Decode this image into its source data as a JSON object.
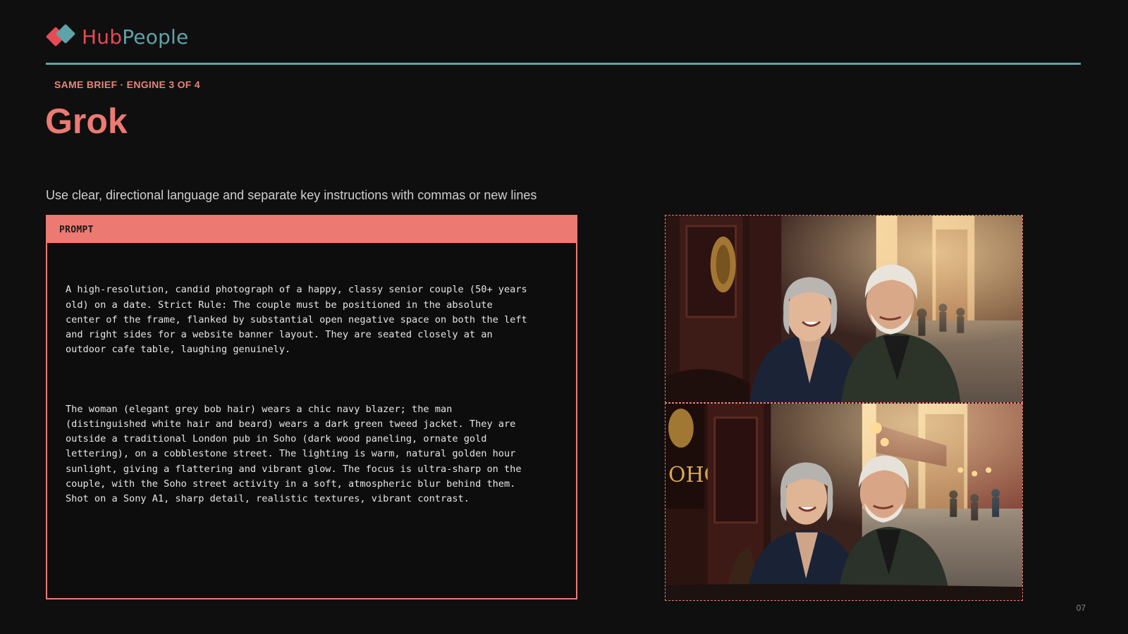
{
  "brand": {
    "part1": "Hub",
    "part2": "People",
    "colors": {
      "hub": "#e64a54",
      "people": "#5fa3a9"
    }
  },
  "kicker": "SAME BRIEF · ENGINE 3 OF 4",
  "title": "Grok",
  "subtitle": "Use clear, directional language and separate key instructions with commas or new lines",
  "prompt": {
    "label": "PROMPT",
    "paragraph1": "A high-resolution, candid photograph of a happy, classy senior couple (50+ years\nold) on a date. Strict Rule: The couple must be positioned in the absolute\ncenter of the frame, flanked by substantial open negative space on both the left\nand right sides for a website banner layout. They are seated closely at an\noutdoor cafe table, laughing genuinely.",
    "paragraph2": "The woman (elegant grey bob hair) wears a chic navy blazer; the man\n(distinguished white hair and beard) wears a dark green tweed jacket. They are\noutside a traditional London pub in Soho (dark wood paneling, ornate gold\nlettering), on a cobblestone street. The lighting is warm, natural golden hour\nsunlight, giving a flattering and vibrant glow. The focus is ultra-sharp on the\ncouple, with the Soho street activity in a soft, atmospheric blur behind them.\nShot on a Sony A1, sharp detail, realistic textures, vibrant contrast."
  },
  "images": [
    {
      "sign_text": ""
    },
    {
      "sign_text": "OHO"
    }
  ],
  "page_number": "07",
  "accent_colors": {
    "coral": "#ec7a73",
    "teal": "#5fa3a9",
    "background": "#0f0f0f"
  }
}
